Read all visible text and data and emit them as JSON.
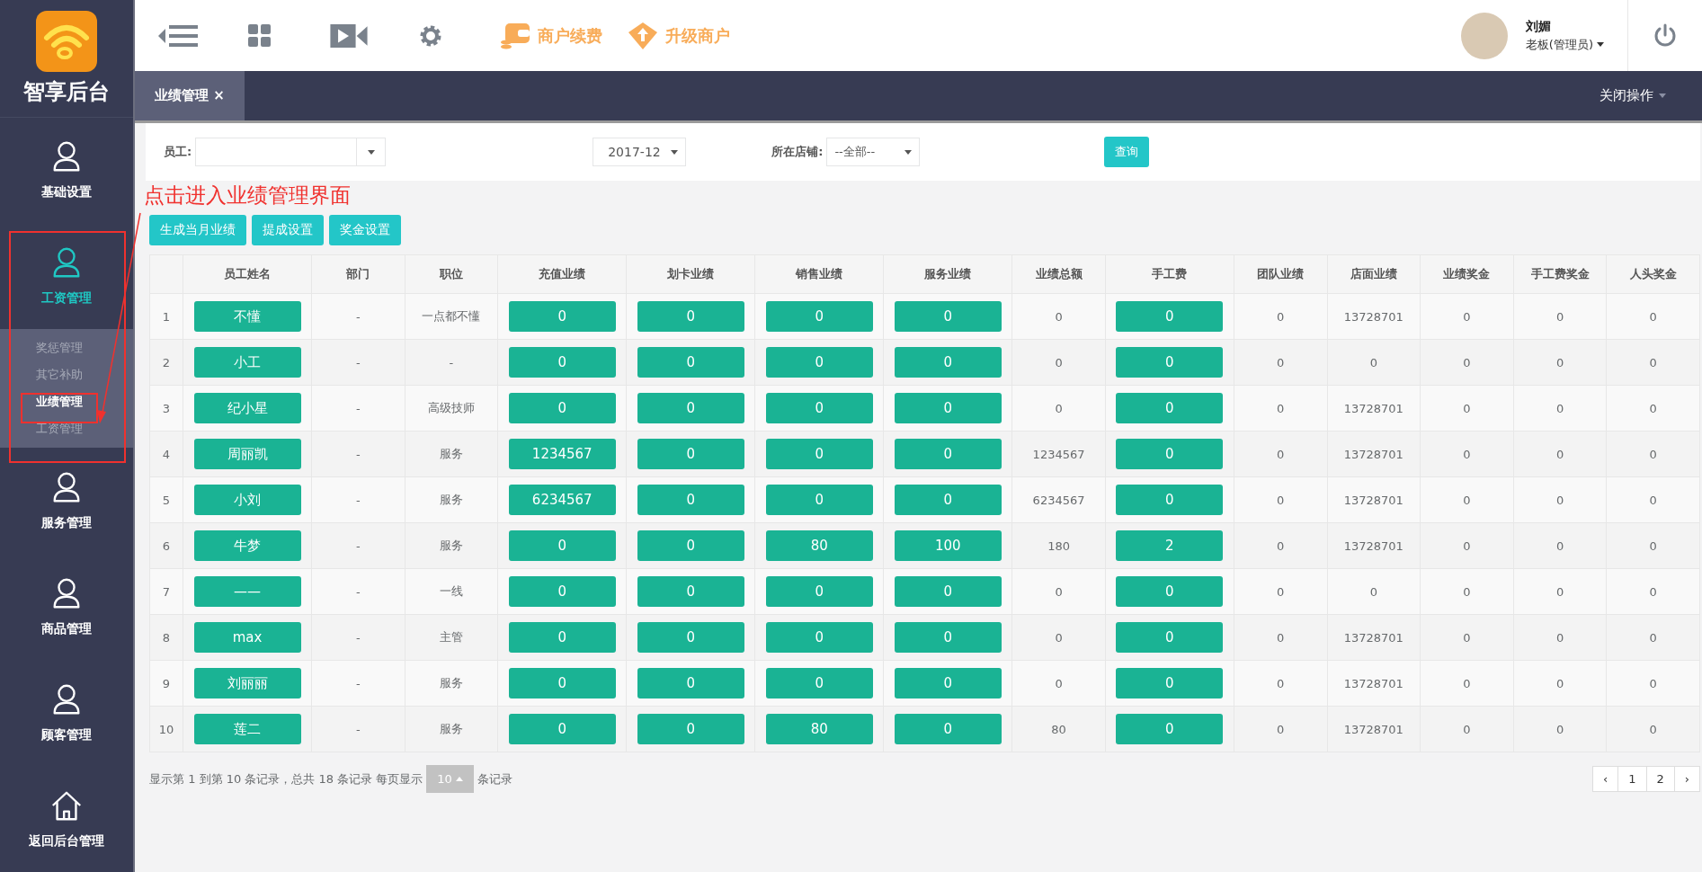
{
  "brand": {
    "title": "智享后台"
  },
  "sidebar": {
    "items": [
      {
        "label": "基础设置",
        "kind": "person",
        "active": false,
        "expanded": false
      },
      {
        "label": "工资管理",
        "kind": "person",
        "active": true,
        "expanded": true,
        "children": [
          {
            "label": "奖惩管理",
            "selected": false
          },
          {
            "label": "其它补助",
            "selected": false
          },
          {
            "label": "业绩管理",
            "selected": true
          },
          {
            "label": "工资管理",
            "selected": false
          }
        ]
      },
      {
        "label": "服务管理",
        "kind": "person",
        "active": false,
        "expanded": false
      },
      {
        "label": "商品管理",
        "kind": "person",
        "active": false,
        "expanded": false
      },
      {
        "label": "顾客管理",
        "kind": "person",
        "active": false,
        "expanded": false
      },
      {
        "label": "返回后台管理",
        "kind": "home",
        "active": false,
        "expanded": false
      }
    ]
  },
  "toolbar": {
    "links": [
      {
        "label": "商户续费",
        "kind": "wallet"
      },
      {
        "label": "升级商户",
        "kind": "upgrade"
      }
    ]
  },
  "user": {
    "name": "刘媚",
    "role": "老板(管理员)"
  },
  "tabs": [
    {
      "label": "业绩管理 ×",
      "selected": true
    }
  ],
  "close_menu": "关闭操作",
  "filters": {
    "employee_label": "员工:",
    "month": "2017-12",
    "store_label": "所在店铺:",
    "store": "--全部--",
    "query_button": "查询"
  },
  "actions": [
    "生成当月业绩",
    "提成设置",
    "奖金设置"
  ],
  "table": {
    "columns": [
      {
        "kind": "index"
      },
      {
        "label": "员工姓名",
        "kind": "button"
      },
      {
        "label": "部门",
        "kind": "text"
      },
      {
        "label": "职位",
        "kind": "text"
      },
      {
        "label": "充值业绩",
        "kind": "button"
      },
      {
        "label": "划卡业绩",
        "kind": "button"
      },
      {
        "label": "销售业绩",
        "kind": "button"
      },
      {
        "label": "服务业绩",
        "kind": "button"
      },
      {
        "label": "业绩总额",
        "kind": "text"
      },
      {
        "label": "手工费",
        "kind": "button"
      },
      {
        "label": "团队业绩",
        "kind": "text"
      },
      {
        "label": "店面业绩",
        "kind": "text"
      },
      {
        "label": "业绩奖金",
        "kind": "text"
      },
      {
        "label": "手工费奖金",
        "kind": "text"
      },
      {
        "label": "人头奖金",
        "kind": "text"
      }
    ],
    "rows": [
      [
        "1",
        "不懂",
        "-",
        "一点都不懂",
        "0",
        "0",
        "0",
        "0",
        "0",
        "0",
        "0",
        "13728701",
        "0",
        "0",
        "0"
      ],
      [
        "2",
        "小工",
        "-",
        "-",
        "0",
        "0",
        "0",
        "0",
        "0",
        "0",
        "0",
        "0",
        "0",
        "0",
        "0"
      ],
      [
        "3",
        "纪小星",
        "-",
        "高级技师",
        "0",
        "0",
        "0",
        "0",
        "0",
        "0",
        "0",
        "13728701",
        "0",
        "0",
        "0"
      ],
      [
        "4",
        "周丽凯",
        "-",
        "服务",
        "1234567",
        "0",
        "0",
        "0",
        "1234567",
        "0",
        "0",
        "13728701",
        "0",
        "0",
        "0"
      ],
      [
        "5",
        "小刘",
        "-",
        "服务",
        "6234567",
        "0",
        "0",
        "0",
        "6234567",
        "0",
        "0",
        "13728701",
        "0",
        "0",
        "0"
      ],
      [
        "6",
        "牛梦",
        "-",
        "服务",
        "0",
        "0",
        "80",
        "100",
        "180",
        "2",
        "0",
        "13728701",
        "0",
        "0",
        "0"
      ],
      [
        "7",
        "——",
        "-",
        "一线",
        "0",
        "0",
        "0",
        "0",
        "0",
        "0",
        "0",
        "0",
        "0",
        "0",
        "0"
      ],
      [
        "8",
        "max",
        "-",
        "主管",
        "0",
        "0",
        "0",
        "0",
        "0",
        "0",
        "0",
        "13728701",
        "0",
        "0",
        "0"
      ],
      [
        "9",
        "刘丽丽",
        "-",
        "服务",
        "0",
        "0",
        "0",
        "0",
        "0",
        "0",
        "0",
        "13728701",
        "0",
        "0",
        "0"
      ],
      [
        "10",
        "莲二",
        "-",
        "服务",
        "0",
        "0",
        "80",
        "0",
        "80",
        "0",
        "0",
        "13728701",
        "0",
        "0",
        "0"
      ]
    ]
  },
  "pagination": {
    "summary": "显示第 1 到第 10 条记录，总共 18 条记录 每页显示",
    "page_size": "10",
    "suffix": "条记录",
    "prev": "‹",
    "pages": [
      "1",
      "2"
    ],
    "next": "›"
  },
  "annotation": {
    "text": "点击进入业绩管理界面"
  }
}
